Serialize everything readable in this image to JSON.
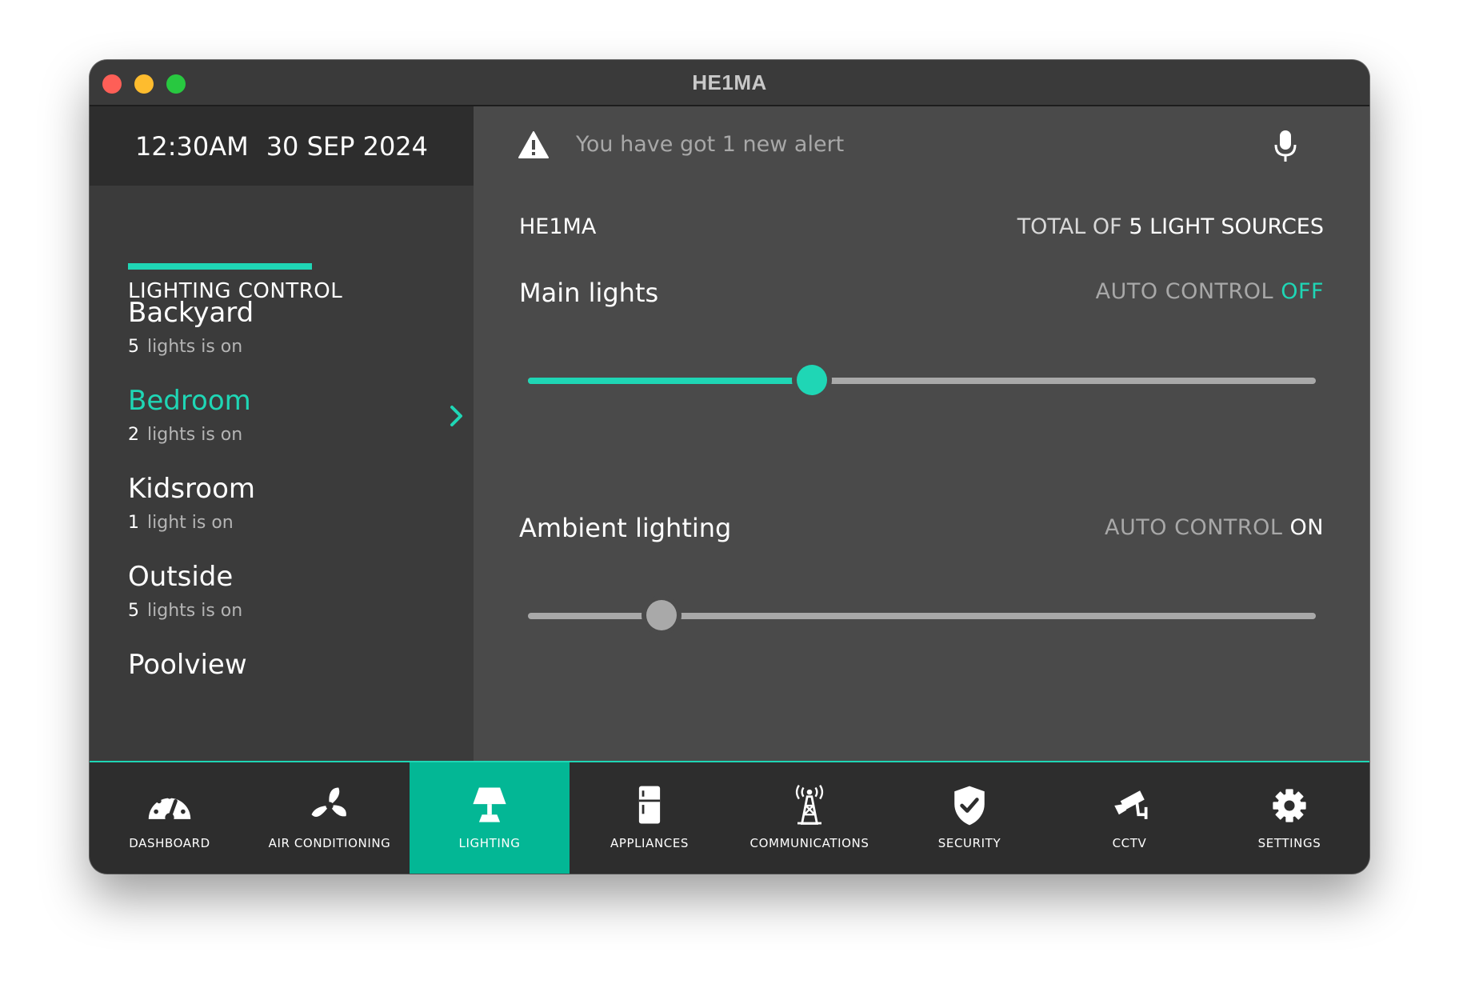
{
  "window": {
    "title": "HE1MA"
  },
  "sidebar": {
    "time": "12:30AM",
    "date": "30 SEP 2024",
    "section_title": "LIGHTING CONTROL",
    "rooms": [
      {
        "name": "Backyard",
        "count": "5",
        "status": "lights is on"
      },
      {
        "name": "Bedroom",
        "count": "2",
        "status": "lights is on",
        "active": true
      },
      {
        "name": "Kidsroom",
        "count": "1",
        "status": "light is on"
      },
      {
        "name": "Outside",
        "count": "5",
        "status": "lights is on"
      },
      {
        "name": "Poolview"
      }
    ]
  },
  "header": {
    "alert_text": "You have got 1 new alert",
    "alert_icon": "warning-triangle-icon",
    "voice_icon": "microphone-icon"
  },
  "lighting": {
    "place": "HE1MA",
    "total_prefix": "TOTAL OF",
    "total_value": "5 LIGHT SOURCES",
    "controls": [
      {
        "title": "Main lights",
        "auto_label": "AUTO CONTROL",
        "auto_state": "OFF",
        "level": 0.36
      },
      {
        "title": "Ambient lighting",
        "auto_label": "AUTO CONTROL",
        "auto_state": "ON",
        "level": 0.17
      }
    ]
  },
  "nav": {
    "items": [
      {
        "label": "DASHBOARD",
        "icon": "gauge-icon"
      },
      {
        "label": "AIR CONDITIONING",
        "icon": "fan-icon"
      },
      {
        "label": "LIGHTING",
        "icon": "lamp-icon",
        "active": true
      },
      {
        "label": "APPLIANCES",
        "icon": "fridge-icon"
      },
      {
        "label": "COMMUNICATIONS",
        "icon": "antenna-icon"
      },
      {
        "label": "SECURITY",
        "icon": "shield-check-icon"
      },
      {
        "label": "CCTV",
        "icon": "camera-icon"
      },
      {
        "label": "SETTINGS",
        "icon": "gear-icon"
      }
    ]
  },
  "colors": {
    "accent": "#1fd6b5",
    "nav_active": "#03b795",
    "panel": "#4a4a4a",
    "sidebar": "#3b3b3b"
  }
}
